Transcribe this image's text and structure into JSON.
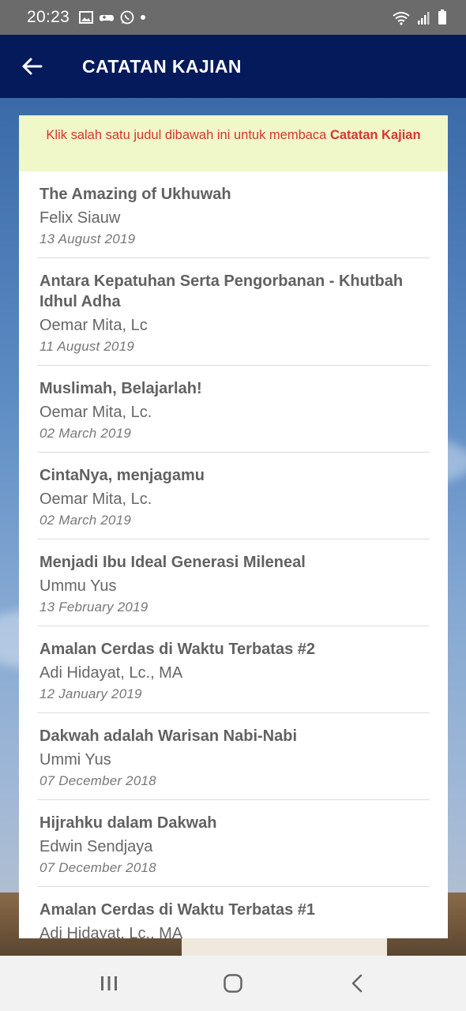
{
  "status_bar": {
    "time": "20:23",
    "icons": [
      "image-icon",
      "game-controller-icon",
      "whatsapp-icon",
      "notification-dot-icon"
    ],
    "right_icons": [
      "wifi-icon",
      "signal-icon",
      "battery-icon"
    ]
  },
  "app_bar": {
    "back_icon": "arrow-left-icon",
    "title": "CATATAN KAJIAN"
  },
  "notice": {
    "text": "Klik salah satu judul dibawah ini untuk membaca ",
    "bold": "Catatan Kajian"
  },
  "items": [
    {
      "title": "The Amazing of Ukhuwah",
      "author": "Felix Siauw",
      "date": "13 August 2019"
    },
    {
      "title": "Antara Kepatuhan Serta Pengorbanan - Khutbah Idhul Adha",
      "author": "Oemar Mita, Lc",
      "date": "11 August 2019"
    },
    {
      "title": "Muslimah, Belajarlah!",
      "author": "Oemar Mita, Lc.",
      "date": "02 March 2019"
    },
    {
      "title": "CintaNya, menjagamu",
      "author": "Oemar Mita, Lc.",
      "date": "02 March 2019"
    },
    {
      "title": "Menjadi Ibu Ideal Generasi Mileneal",
      "author": "Ummu Yus",
      "date": "13 February 2019"
    },
    {
      "title": "Amalan Cerdas di Waktu Terbatas #2",
      "author": "Adi Hidayat, Lc., MA",
      "date": "12 January 2019"
    },
    {
      "title": "Dakwah adalah Warisan Nabi-Nabi",
      "author": "Ummi Yus",
      "date": "07 December 2018"
    },
    {
      "title": "Hijrahku dalam Dakwah",
      "author": "Edwin Sendjaya",
      "date": "07 December 2018"
    },
    {
      "title": "Amalan Cerdas di Waktu Terbatas #1",
      "author": "Adi Hidayat, Lc., MA",
      "date": ""
    }
  ],
  "nav_bar": {
    "buttons": [
      "recent-apps-icon",
      "home-icon",
      "back-icon"
    ]
  },
  "colors": {
    "app_bar": "#041a5a",
    "notice_bg": "#f0f7c8",
    "notice_text": "#d93434",
    "status_bar": "#6b6b6b"
  }
}
